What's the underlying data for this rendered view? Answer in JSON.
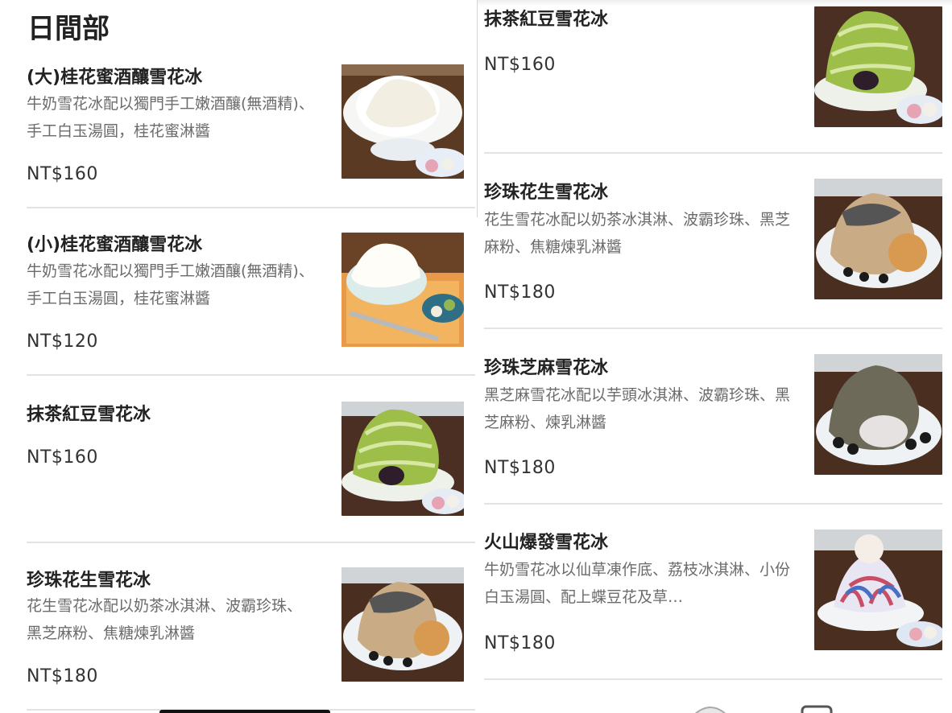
{
  "left": {
    "section_title": "日間部",
    "items": [
      {
        "name": "(大)桂花蜜酒釀雪花冰",
        "desc": "牛奶雪花冰配以獨門手工嫩酒釀(無酒精)、手工白玉湯圓，桂花蜜淋醬",
        "price": "NT$160"
      },
      {
        "name": "(小)桂花蜜酒釀雪花冰",
        "desc": "牛奶雪花冰配以獨門手工嫩酒釀(無酒精)、手工白玉湯圓，桂花蜜淋醬",
        "price": "NT$120"
      },
      {
        "name": "抹茶紅豆雪花冰",
        "desc": "",
        "price": "NT$160"
      },
      {
        "name": "珍珠花生雪花冰",
        "desc": "花生雪花冰配以奶茶冰淇淋、波霸珍珠、黑芝麻粉、焦糖煉乳淋醬",
        "price": "NT$180"
      }
    ]
  },
  "right": {
    "items": [
      {
        "name": "抹茶紅豆雪花冰",
        "desc": "",
        "price": "NT$160"
      },
      {
        "name": "珍珠花生雪花冰",
        "desc": "花生雪花冰配以奶茶冰淇淋、波霸珍珠、黑芝麻粉、焦糖煉乳淋醬",
        "price": "NT$180"
      },
      {
        "name": "珍珠芝麻雪花冰",
        "desc": "黑芝麻雪花冰配以芋頭冰淇淋、波霸珍珠、黑芝麻粉、煉乳淋醬",
        "price": "NT$180"
      },
      {
        "name": "火山爆發雪花冰",
        "desc": "牛奶雪花冰以仙草凍作底、荔枝冰淇淋、小份白玉湯圓、配上蝶豆花及草…",
        "price": "NT$180"
      }
    ]
  },
  "colors": {
    "accent_text": "#222222",
    "secondary_text": "#6b6b6b",
    "divider": "#e3e3e3"
  },
  "icons": {
    "home_indicator": "home-indicator-bar"
  }
}
